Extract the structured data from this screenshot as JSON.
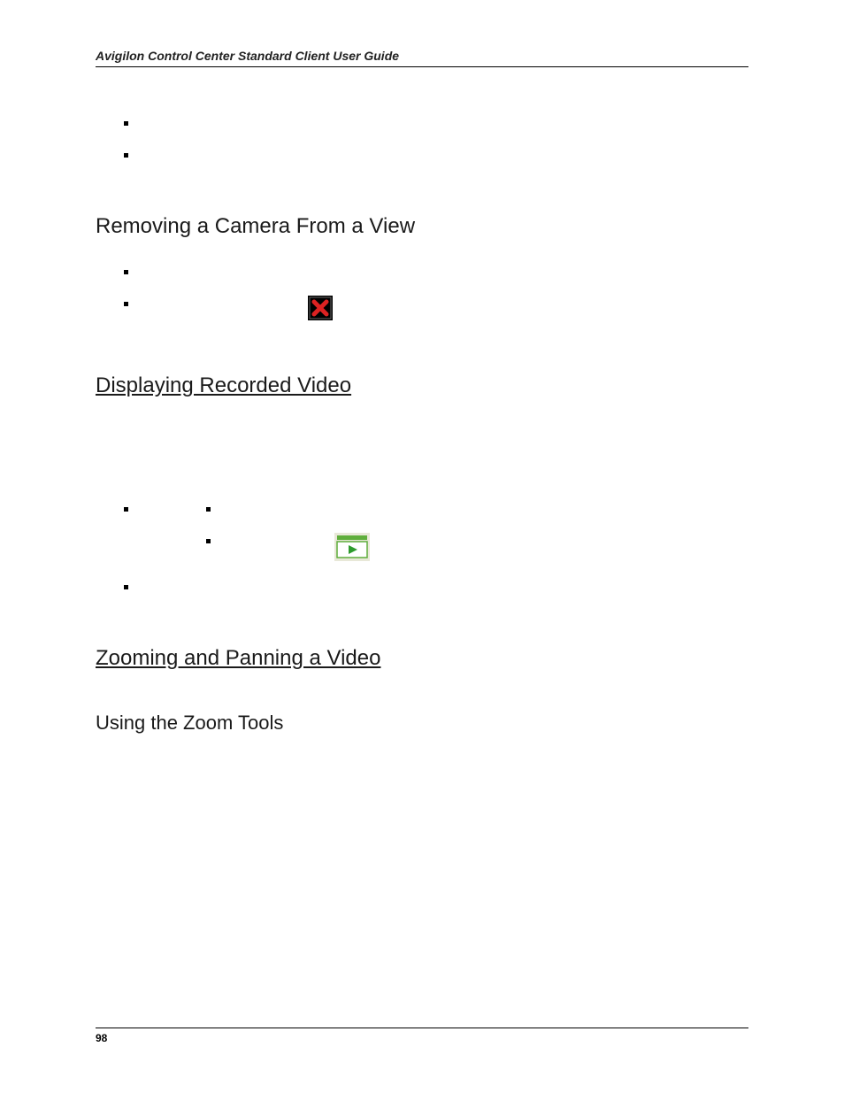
{
  "header": {
    "title": "Avigilon Control Center Standard Client User Guide"
  },
  "topBullets": [
    {
      "text": ""
    },
    {
      "text": ""
    }
  ],
  "section1": {
    "heading": "Removing a Camera From a View",
    "bullets": [
      {
        "text": ""
      },
      {
        "text": "",
        "hasCloseIcon": true
      }
    ]
  },
  "section2": {
    "heading": "Displaying Recorded Video",
    "bullets": [
      {
        "text": "",
        "sub": [
          {
            "text": ""
          },
          {
            "text": "",
            "hasRecordedIcon": true
          }
        ]
      },
      {
        "text": ""
      }
    ]
  },
  "section3": {
    "heading": "Zooming and Panning a Video",
    "sub": {
      "heading": "Using the Zoom Tools"
    }
  },
  "footer": {
    "pageNumber": "98"
  },
  "icons": {
    "close": "close-icon",
    "recorded": "recorded-icon"
  }
}
